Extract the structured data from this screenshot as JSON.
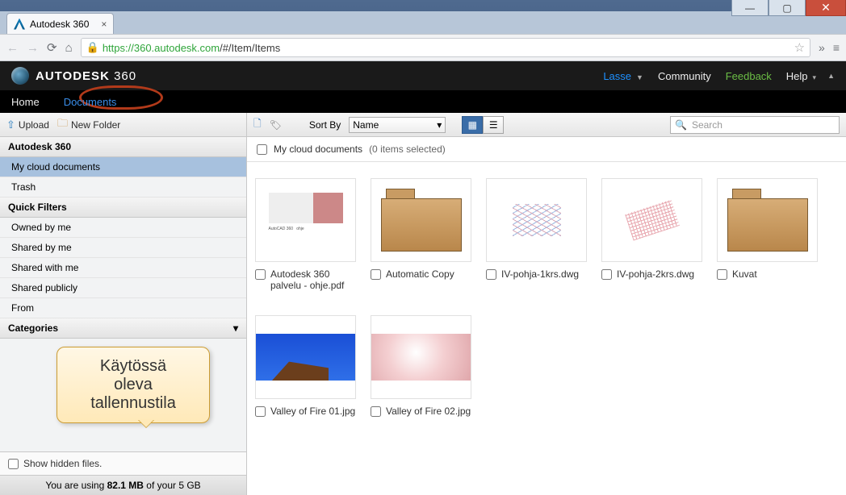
{
  "browser": {
    "tab_title": "Autodesk 360",
    "url_scheme": "https://",
    "url_host": "360.autodesk.com",
    "url_path": "/#/Item/Items"
  },
  "header": {
    "brand_strong": "AUTODESK",
    "brand_light": " 360",
    "user": "Lasse",
    "community": "Community",
    "feedback": "Feedback",
    "help": "Help"
  },
  "tabs": {
    "home": "Home",
    "documents": "Documents"
  },
  "toolbar": {
    "upload": "Upload",
    "new_folder": "New Folder",
    "sort_label": "Sort By",
    "sort_value": "Name",
    "search_placeholder": "Search"
  },
  "sidebar": {
    "root": "Autodesk 360",
    "items": [
      "My cloud documents",
      "Trash"
    ],
    "quick_filters_hdr": "Quick Filters",
    "quick_filters": [
      "Owned by me",
      "Shared by me",
      "Shared with me",
      "Shared publicly",
      "From"
    ],
    "categories_hdr": "Categories",
    "show_hidden": "Show hidden files.",
    "quota_pre": "You are using ",
    "quota_used": "82.1 MB",
    "quota_post": " of your 5 GB"
  },
  "main": {
    "breadcrumb": "My cloud documents",
    "selected": "(0 items selected)",
    "items": [
      {
        "label": "Autodesk 360 palvelu - ohje.pdf",
        "type": "doc"
      },
      {
        "label": "Automatic Copy",
        "type": "folder"
      },
      {
        "label": "IV-pohja-1krs.dwg",
        "type": "dwg"
      },
      {
        "label": "IV-pohja-2krs.dwg",
        "type": "dwg2"
      },
      {
        "label": "Kuvat",
        "type": "folder"
      },
      {
        "label": "Valley of Fire 01.jpg",
        "type": "photo1"
      },
      {
        "label": "Valley of Fire 02.jpg",
        "type": "photo2"
      }
    ]
  },
  "callout": {
    "line1": "Käytössä",
    "line2": "oleva",
    "line3": "tallennustila"
  }
}
